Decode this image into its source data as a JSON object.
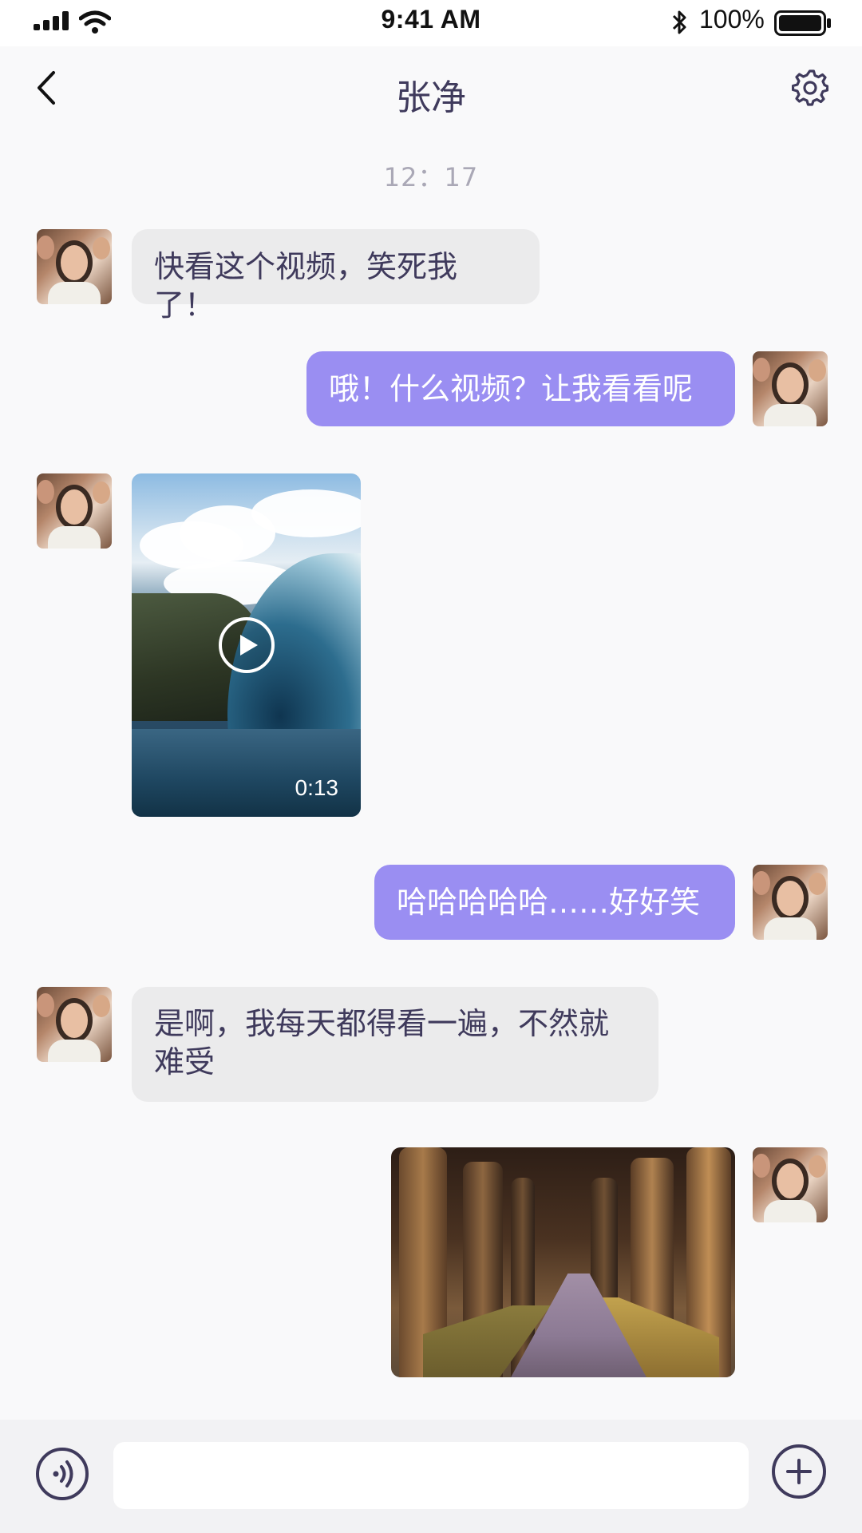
{
  "status_bar": {
    "time": "9:41 AM",
    "battery": "100%"
  },
  "nav": {
    "title": "张净"
  },
  "timestamp": "12：17",
  "messages": [
    {
      "side": "left",
      "type": "text",
      "text": "快看这个视频，笑死我了！"
    },
    {
      "side": "right",
      "type": "text",
      "text": "哦！什么视频？让我看看呢"
    },
    {
      "side": "left",
      "type": "video",
      "duration": "0:13"
    },
    {
      "side": "right",
      "type": "text",
      "text": "哈哈哈哈哈……好好笑"
    },
    {
      "side": "left",
      "type": "text",
      "text": "是啊，我每天都得看一遍，不然就难受"
    },
    {
      "side": "right",
      "type": "image"
    }
  ],
  "colors": {
    "bubble_right": "#9a8ef2",
    "bubble_left": "#ebebec",
    "text_primary": "#3f3a5c",
    "timestamp": "#aaa8b6"
  },
  "icons": {
    "back": "chevron-left-icon",
    "settings": "gear-icon",
    "voice": "voice-icon",
    "plus": "plus-icon",
    "play": "play-icon"
  },
  "input": {
    "value": "",
    "placeholder": ""
  }
}
